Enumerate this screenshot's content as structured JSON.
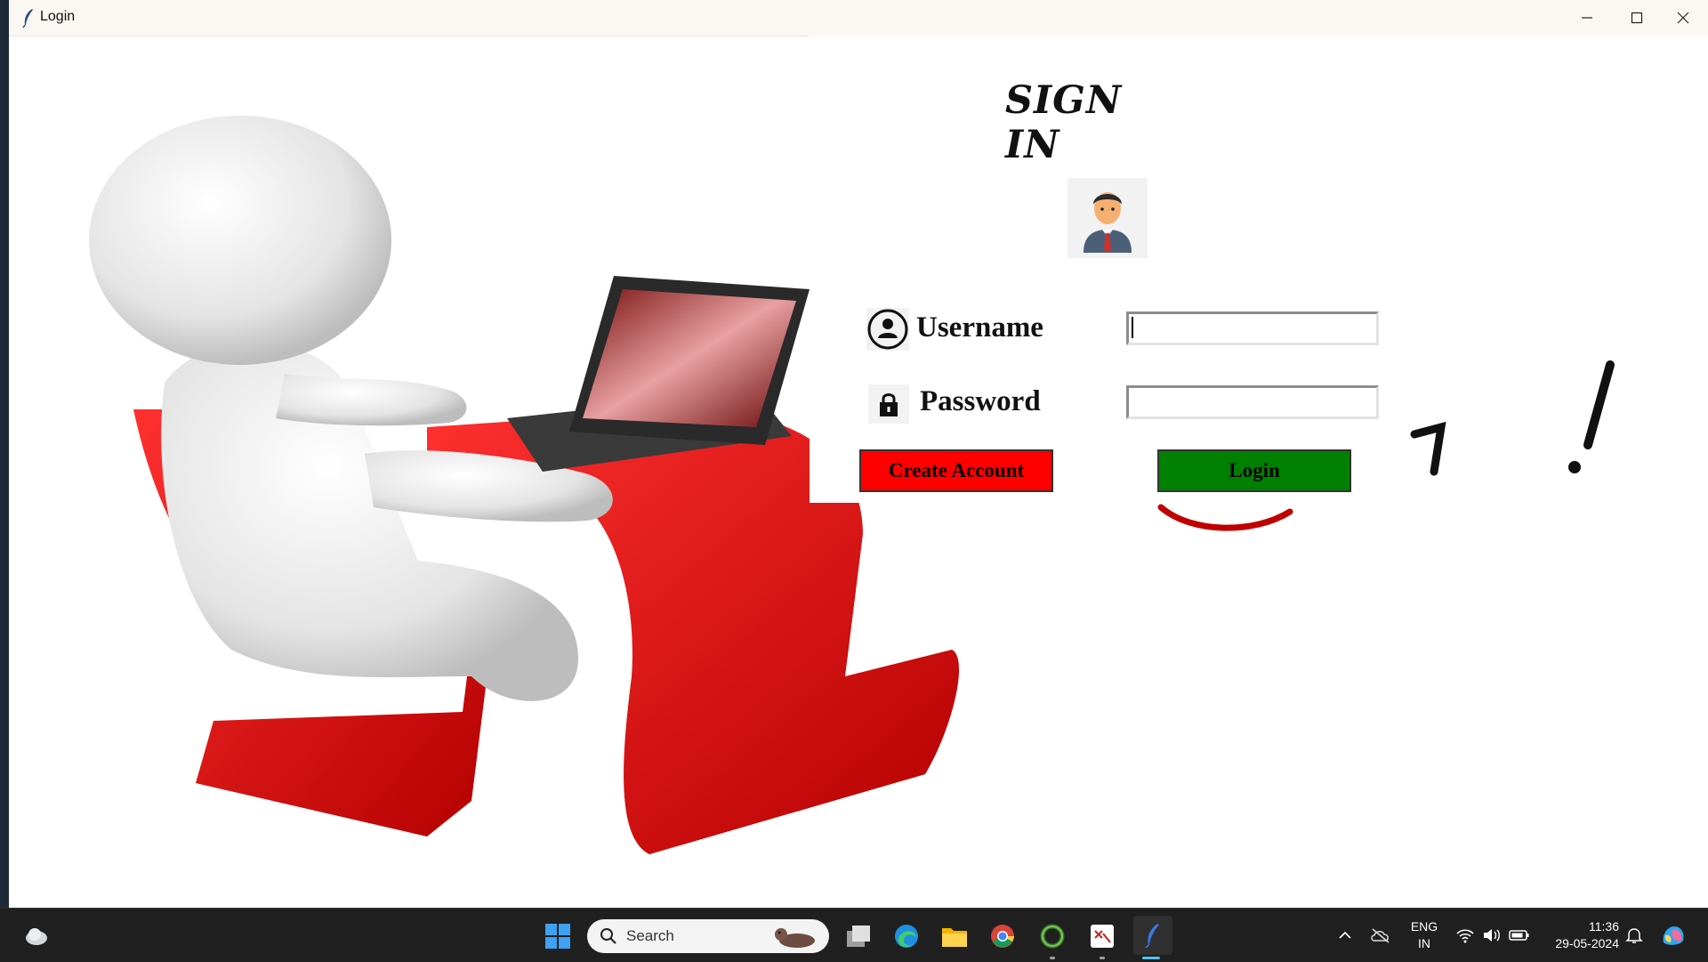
{
  "window": {
    "title": "Login"
  },
  "form": {
    "heading": "SIGN IN",
    "username_label": "Username",
    "password_label": "Password",
    "username_value": "",
    "password_value": "",
    "create_button": "Create Account",
    "login_button": "Login"
  },
  "colors": {
    "create_button": "#ff0000",
    "login_button": "#008000",
    "taskbar": "#202020"
  },
  "taskbar": {
    "search_placeholder": "Search",
    "language_line1": "ENG",
    "language_line2": "IN",
    "time": "11:36",
    "date": "29-05-2024",
    "apps": [
      "weather-icon",
      "start-icon",
      "task-view-icon",
      "edge-icon",
      "file-explorer-icon",
      "chrome-icon",
      "app-ring-icon",
      "app-sheet-icon",
      "python-feather-icon"
    ]
  }
}
